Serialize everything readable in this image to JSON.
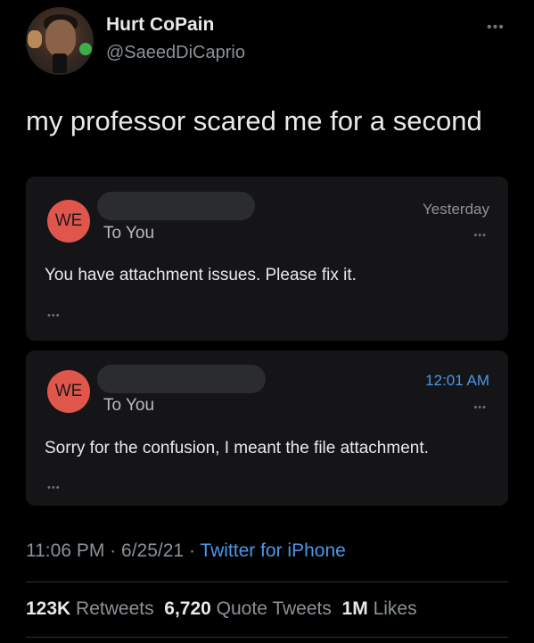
{
  "tweet": {
    "display_name": "Hurt CoPain",
    "handle": "@SaeedDiCaprio",
    "more_icon": "more-horizontal-icon",
    "text": "my professor scared me for a second",
    "time": "11:06 PM",
    "sep": "·",
    "date": "6/25/21",
    "source": "Twitter for iPhone"
  },
  "messages": [
    {
      "avatar_text": "WE",
      "recipient": "To You",
      "time": "Yesterday",
      "body": "You have attachment issues. Please fix it.",
      "more": "•••",
      "footer_more": "•••"
    },
    {
      "avatar_text": "WE",
      "recipient": "To You",
      "time": "12:01 AM",
      "body": "Sorry for the confusion, I meant the file attachment.",
      "more": "•••",
      "footer_more": "•••"
    }
  ],
  "stats": {
    "retweets_count": "123K",
    "retweets_label": "Retweets",
    "quotes_count": "6,720",
    "quotes_label": "Quote Tweets",
    "likes_count": "1M",
    "likes_label": "Likes"
  },
  "colors": {
    "background": "#000000",
    "card": "#151518",
    "avatar_red": "#e0564d",
    "link_blue": "#4a98e8"
  }
}
